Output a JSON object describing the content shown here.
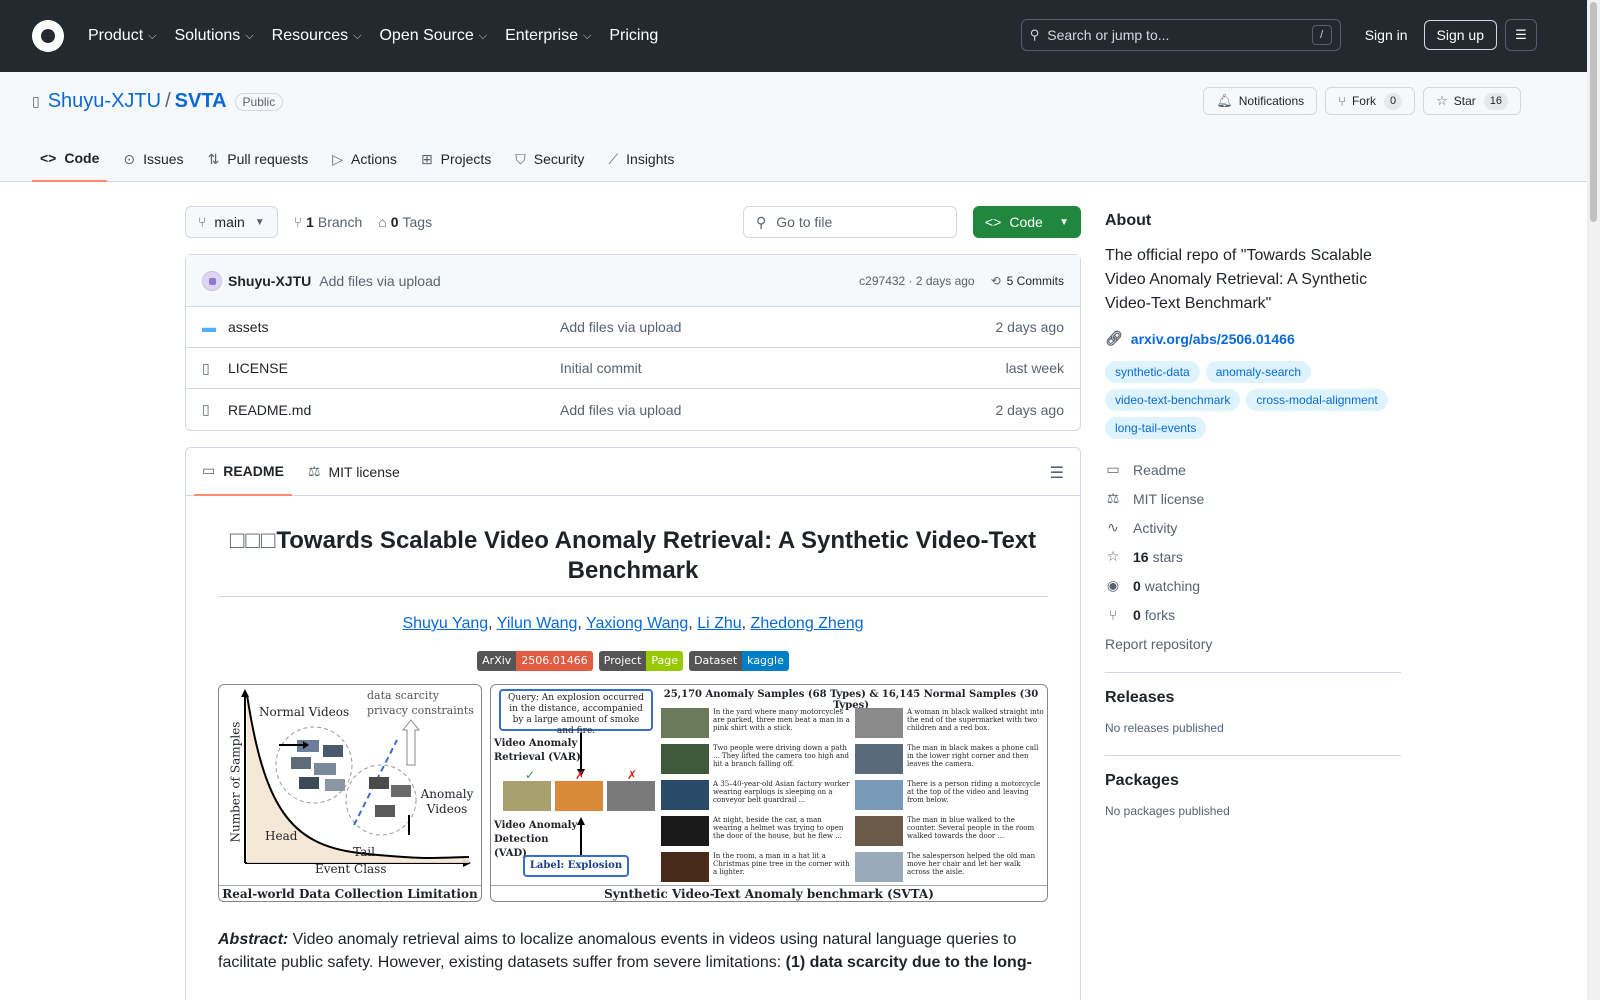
{
  "header": {
    "nav": [
      {
        "label": "Product",
        "dropdown": true
      },
      {
        "label": "Solutions",
        "dropdown": true
      },
      {
        "label": "Resources",
        "dropdown": true
      },
      {
        "label": "Open Source",
        "dropdown": true
      },
      {
        "label": "Enterprise",
        "dropdown": true
      },
      {
        "label": "Pricing",
        "dropdown": false
      }
    ],
    "search_placeholder": "Search or jump to...",
    "search_shortcut": "/",
    "sign_in": "Sign in",
    "sign_up": "Sign up"
  },
  "repo": {
    "owner": "Shuyu-XJTU",
    "separator": "/",
    "name": "SVTA",
    "visibility": "Public",
    "notifications_label": "Notifications",
    "fork_label": "Fork",
    "fork_count": "0",
    "star_label": "Star",
    "star_count": "16",
    "tabs": [
      {
        "label": "Code",
        "icon": "code-icon",
        "active": true
      },
      {
        "label": "Issues",
        "icon": "issue-icon",
        "active": false
      },
      {
        "label": "Pull requests",
        "icon": "pull-request-icon",
        "active": false
      },
      {
        "label": "Actions",
        "icon": "play-icon",
        "active": false
      },
      {
        "label": "Projects",
        "icon": "table-icon",
        "active": false
      },
      {
        "label": "Security",
        "icon": "shield-icon",
        "active": false
      },
      {
        "label": "Insights",
        "icon": "graph-icon",
        "active": false
      }
    ]
  },
  "toolbar": {
    "branch": "main",
    "branch_count": "1",
    "branch_label": "Branch",
    "tag_count": "0",
    "tag_label": "Tags",
    "goto_placeholder": "Go to file",
    "code_button": "Code"
  },
  "commit": {
    "author": "Shuyu-XJTU",
    "message": "Add files via upload",
    "hash_time": "c297432 · 2 days ago",
    "commits_label": "5 Commits"
  },
  "files": [
    {
      "name": "assets",
      "type": "folder",
      "message": "Add files via upload",
      "date": "2 days ago"
    },
    {
      "name": "LICENSE",
      "type": "file",
      "message": "Initial commit",
      "date": "last week"
    },
    {
      "name": "README.md",
      "type": "file",
      "message": "Add files via upload",
      "date": "2 days ago"
    }
  ],
  "readme": {
    "tab_readme": "README",
    "tab_license": "MIT license",
    "title_prefix": "□□□",
    "title": "Towards Scalable Video Anomaly Retrieval: A Synthetic Video-Text Benchmark",
    "authors": [
      "Shuyu Yang",
      "Yilun Wang",
      "Yaxiong Wang",
      "Li Zhu",
      "Zhedong Zheng"
    ],
    "shields": [
      {
        "left": "ArXiv",
        "right": "2506.01466",
        "color": "#e05d44"
      },
      {
        "left": "Project",
        "right": "Page",
        "color": "#97ca00"
      },
      {
        "left": "Dataset",
        "right": "kaggle",
        "color": "#007ec6"
      }
    ],
    "figure": {
      "left_caption": "Real-world Data Collection Limitation",
      "left_labels": {
        "normal_videos": "Normal Videos",
        "data_scarcity": "data scarcity",
        "privacy": "privacy constraints",
        "anomaly_videos": "Anomaly Videos",
        "head": "Head",
        "tail": "Tail",
        "x_axis": "Event Class",
        "y_axis": "Number of Samples"
      },
      "right_caption": "Synthetic Video-Text Anomaly benchmark (SVTA)",
      "right_heading": "25,170 Anomaly Samples (68 Types)  &  16,145 Normal Samples (30 Types)",
      "query_text": "Query: An explosion occurred in the distance, accompanied by a large amount of smoke and fire.",
      "var_label": "Video Anomaly Retrieval (VAR)",
      "vad_label": "Video Anomaly Detection (VAD)",
      "label_text": "Label: Explosion",
      "anomaly_samples": [
        "In the yard where many motorcycles are parked, three men beat a man in a pink shirt with a stick.",
        "Two people were driving down a path ... They lifted the camera too high and hit a branch falling off.",
        "A 35–40-year-old Asian factory worker wearing earplugs is sleeping on a conveyor belt guardrail ...",
        "At night, beside the car, a man wearing a helmet was trying to open the door of the house, but he flew ...",
        "In the room, a man in a hat lit a Christmas pine tree in the corner with a lighter."
      ],
      "normal_samples": [
        "A woman in black walked straight into the end of the supermarket with two children and a red box.",
        "The man in black makes a phone call in the lower right corner and then leaves the camera.",
        "There is a person riding a motorcycle at the top of the video and leaving from below.",
        "The man in blue walked to the counter. Several people in the room walked towards the door ...",
        "The salesperson helped the old man move her chair and let her walk across the aisle."
      ]
    },
    "abstract_label": "Abstract:",
    "abstract_text": " Video anomaly retrieval aims to localize anomalous events in videos using natural language queries to facilitate public safety. However, existing datasets suffer from severe limitations: ",
    "abstract_bold": "(1) data scarcity due to the long-"
  },
  "sidebar": {
    "about_heading": "About",
    "description": "The official repo of \"Towards Scalable Video Anomaly Retrieval: A Synthetic Video-Text Benchmark\"",
    "link": "arxiv.org/abs/2506.01466",
    "topics": [
      "synthetic-data",
      "anomaly-search",
      "video-text-benchmark",
      "cross-modal-alignment",
      "long-tail-events"
    ],
    "items": [
      {
        "icon": "book-icon",
        "bold": "",
        "label": "Readme"
      },
      {
        "icon": "law-icon",
        "bold": "",
        "label": "MIT license"
      },
      {
        "icon": "pulse-icon",
        "bold": "",
        "label": "Activity"
      },
      {
        "icon": "star-icon",
        "bold": "16",
        "label": "stars"
      },
      {
        "icon": "eye-icon",
        "bold": "0",
        "label": "watching"
      },
      {
        "icon": "fork-icon",
        "bold": "0",
        "label": "forks"
      }
    ],
    "report": "Report repository",
    "releases_heading": "Releases",
    "releases_text": "No releases published",
    "packages_heading": "Packages",
    "packages_text": "No packages published"
  },
  "colors": {
    "header_bg": "#24292f",
    "accent": "#0969da",
    "primary_button": "#1f883d",
    "active_tab_underline": "#fd8c73"
  }
}
